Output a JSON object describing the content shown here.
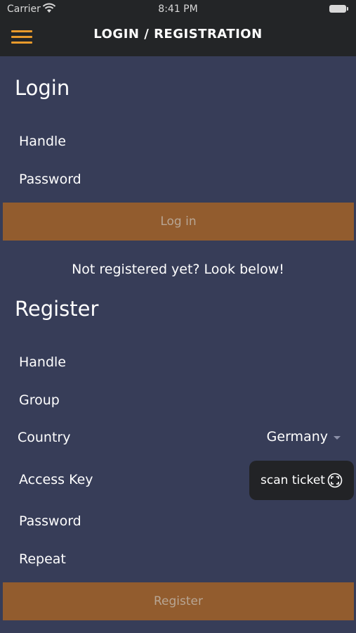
{
  "status_bar": {
    "carrier": "Carrier",
    "time": "8:41 PM"
  },
  "header": {
    "title": "LOGIN / REGISTRATION",
    "menu_icon": "hamburger-icon",
    "accent": "#e89a2c"
  },
  "login": {
    "title": "Login",
    "handle_placeholder": "Handle",
    "password_placeholder": "Password",
    "submit_label": "Log in"
  },
  "note": "Not registered yet? Look below!",
  "register": {
    "title": "Register",
    "handle_placeholder": "Handle",
    "group_placeholder": "Group",
    "country_label": "Country",
    "country_value": "Germany",
    "access_key_placeholder": "Access Key",
    "scan_label": "scan ticket",
    "password_placeholder": "Password",
    "repeat_placeholder": "Repeat",
    "submit_label": "Register"
  },
  "colors": {
    "background": "#373d58",
    "topbar": "#232527",
    "button": "#925c2e",
    "button_text": "#b8a694"
  }
}
